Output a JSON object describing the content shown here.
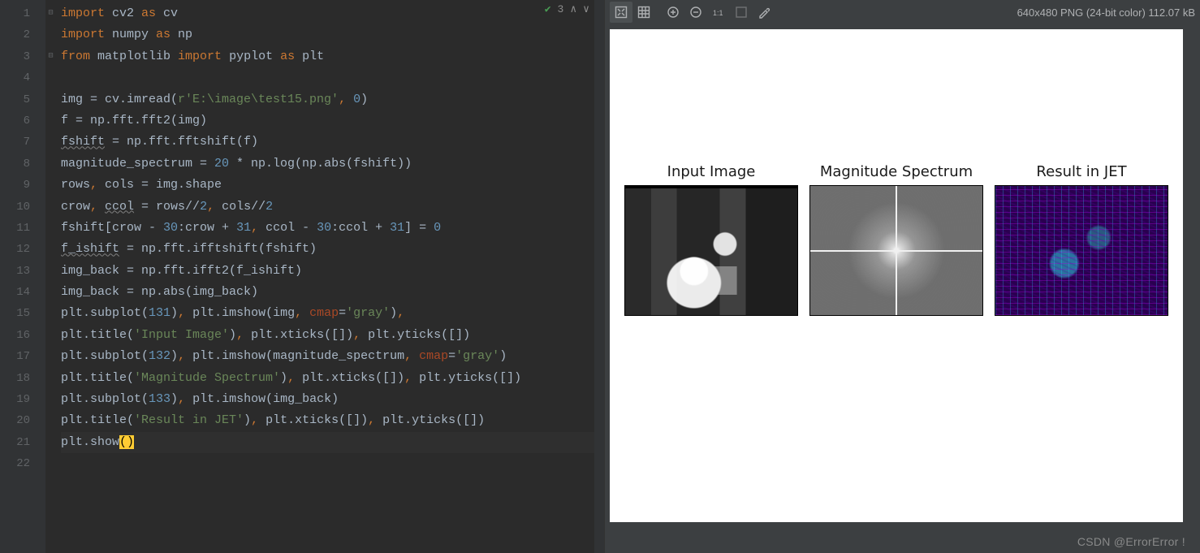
{
  "editor": {
    "problems_badge": "3",
    "lines": [
      [
        [
          "k",
          "import"
        ],
        [
          "p",
          " cv2 "
        ],
        [
          "k",
          "as"
        ],
        [
          "p",
          " cv"
        ]
      ],
      [
        [
          "k",
          "import"
        ],
        [
          "p",
          " numpy "
        ],
        [
          "k",
          "as"
        ],
        [
          "p",
          " np"
        ]
      ],
      [
        [
          "k",
          "from"
        ],
        [
          "p",
          " matplotlib "
        ],
        [
          "k",
          "import"
        ],
        [
          "p",
          " pyplot "
        ],
        [
          "k",
          "as"
        ],
        [
          "p",
          " plt"
        ]
      ],
      [],
      [
        [
          "p",
          "img = cv.imread("
        ],
        [
          "s",
          "r'E:\\image\\test15.png'"
        ],
        [
          "k",
          ", "
        ],
        [
          "n",
          "0"
        ],
        [
          "p",
          ")"
        ]
      ],
      [
        [
          "p",
          "f = np.fft.fft2(img)"
        ]
      ],
      [
        [
          "u",
          "fshift"
        ],
        [
          "p",
          " = np.fft.fftshift(f)"
        ]
      ],
      [
        [
          "p",
          "magnitude_spectrum = "
        ],
        [
          "n",
          "20"
        ],
        [
          "p",
          " * np.log(np.abs(fshift))"
        ]
      ],
      [
        [
          "p",
          "rows"
        ],
        [
          "k",
          ", "
        ],
        [
          "p",
          "cols = img.shape"
        ]
      ],
      [
        [
          "p",
          "crow"
        ],
        [
          "k",
          ", "
        ],
        [
          "u",
          "ccol"
        ],
        [
          "p",
          " = rows//"
        ],
        [
          "n",
          "2"
        ],
        [
          "k",
          ", "
        ],
        [
          "p",
          "cols//"
        ],
        [
          "n",
          "2"
        ]
      ],
      [
        [
          "p",
          "fshift[crow - "
        ],
        [
          "n",
          "30"
        ],
        [
          "p",
          ":crow + "
        ],
        [
          "n",
          "31"
        ],
        [
          "k",
          ", "
        ],
        [
          "p",
          "ccol - "
        ],
        [
          "n",
          "30"
        ],
        [
          "p",
          ":ccol + "
        ],
        [
          "n",
          "31"
        ],
        [
          "p",
          "] = "
        ],
        [
          "n",
          "0"
        ]
      ],
      [
        [
          "u",
          "f_ishift"
        ],
        [
          "p",
          " = np.fft.ifftshift(fshift)"
        ]
      ],
      [
        [
          "p",
          "img_back = np.fft.ifft2(f_ishift)"
        ]
      ],
      [
        [
          "p",
          "img_back = np.abs(img_back)"
        ]
      ],
      [
        [
          "p",
          "plt.subplot("
        ],
        [
          "n",
          "131"
        ],
        [
          "p",
          ")"
        ],
        [
          "k",
          ", "
        ],
        [
          "p",
          "plt.imshow(img"
        ],
        [
          "k",
          ", "
        ],
        [
          "kw",
          "cmap"
        ],
        [
          "p",
          "="
        ],
        [
          "s",
          "'gray'"
        ],
        [
          "p",
          ")"
        ],
        [
          "k",
          ","
        ]
      ],
      [
        [
          "p",
          "plt.title("
        ],
        [
          "s",
          "'Input Image'"
        ],
        [
          "p",
          ")"
        ],
        [
          "k",
          ", "
        ],
        [
          "p",
          "plt.xticks([])"
        ],
        [
          "k",
          ", "
        ],
        [
          "p",
          "plt.yticks([])"
        ]
      ],
      [
        [
          "p",
          "plt.subplot("
        ],
        [
          "n",
          "132"
        ],
        [
          "p",
          ")"
        ],
        [
          "k",
          ", "
        ],
        [
          "p",
          "plt.imshow(magnitude_spectrum"
        ],
        [
          "k",
          ", "
        ],
        [
          "kw",
          "cmap"
        ],
        [
          "p",
          "="
        ],
        [
          "s",
          "'gray'"
        ],
        [
          "p",
          ")"
        ]
      ],
      [
        [
          "p",
          "plt.title("
        ],
        [
          "s",
          "'Magnitude Spectrum'"
        ],
        [
          "p",
          ")"
        ],
        [
          "k",
          ", "
        ],
        [
          "p",
          "plt.xticks([])"
        ],
        [
          "k",
          ", "
        ],
        [
          "p",
          "plt.yticks([])"
        ]
      ],
      [
        [
          "p",
          "plt.subplot("
        ],
        [
          "n",
          "133"
        ],
        [
          "p",
          ")"
        ],
        [
          "k",
          ", "
        ],
        [
          "p",
          "plt.imshow(img_back)"
        ]
      ],
      [
        [
          "p",
          "plt.title("
        ],
        [
          "s",
          "'Result in JET'"
        ],
        [
          "p",
          ")"
        ],
        [
          "k",
          ", "
        ],
        [
          "p",
          "plt.xticks([])"
        ],
        [
          "k",
          ", "
        ],
        [
          "p",
          "plt.yticks([])"
        ]
      ],
      [
        [
          "p",
          "plt.show"
        ],
        [
          "caret",
          "()"
        ]
      ],
      []
    ],
    "caret_line_index": 20
  },
  "preview": {
    "info": "640x480 PNG (24-bit color) 112.07 kB",
    "captions": [
      "Input Image",
      "Magnitude Spectrum",
      "Result in JET"
    ]
  },
  "watermark": "CSDN @ErrorError !"
}
